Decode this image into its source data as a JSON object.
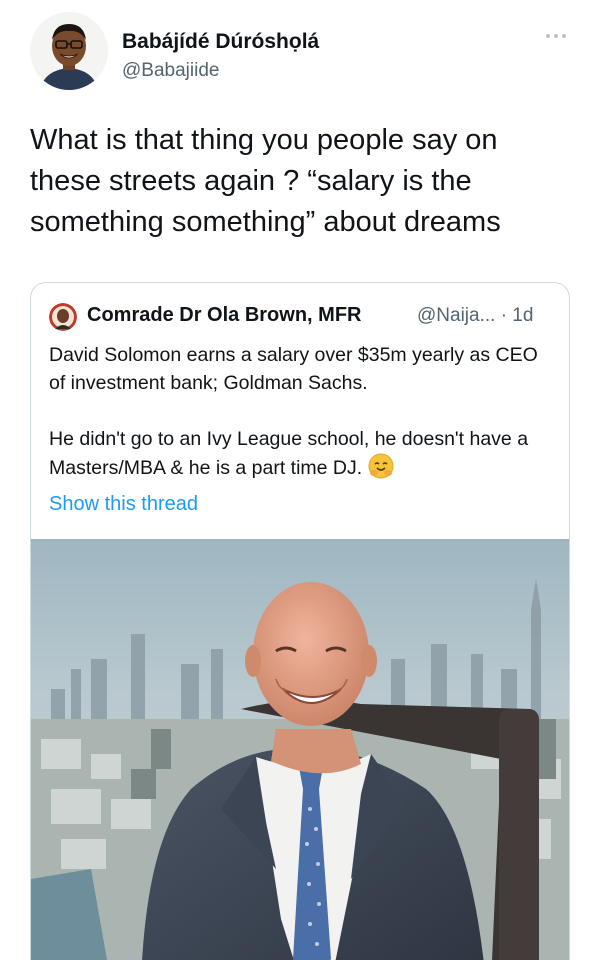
{
  "tweet": {
    "author_name": "Babájídé Dúróshọlá",
    "author_handle": "@Babajiide",
    "text": "What is that thing you people say on these streets again ? “salary is the something something” about dreams"
  },
  "quoted_tweet": {
    "author_name": "Comrade Dr Ola Brown, MFR",
    "author_handle_time": "@Naija... · 1d",
    "paragraph_1": "David Solomon earns a salary over $35m yearly as CEO of investment bank; Goldman Sachs.",
    "paragraph_2": "He didn't go to an Ivy League school, he doesn't have a Masters/MBA & he is a part time DJ.",
    "show_thread": "Show this thread"
  },
  "icons": {
    "more": "more-options-icon",
    "emoji": "hugging-face-emoji-icon"
  },
  "colors": {
    "link": "#1d9bf0",
    "secondary_text": "#536471",
    "border": "#cfd9de"
  }
}
